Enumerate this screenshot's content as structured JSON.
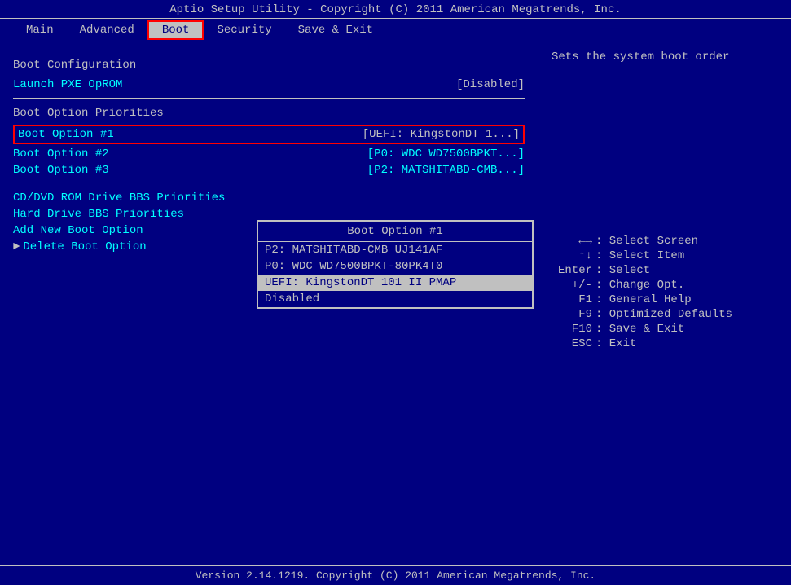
{
  "title_bar": {
    "text": "Aptio Setup Utility - Copyright (C) 2011 American Megatrends, Inc."
  },
  "menu": {
    "items": [
      {
        "id": "main",
        "label": "Main",
        "active": false
      },
      {
        "id": "advanced",
        "label": "Advanced",
        "active": false
      },
      {
        "id": "boot",
        "label": "Boot",
        "active": true
      },
      {
        "id": "security",
        "label": "Security",
        "active": false
      },
      {
        "id": "save_exit",
        "label": "Save & Exit",
        "active": false
      }
    ]
  },
  "left_panel": {
    "boot_config_header": "Boot Configuration",
    "launch_pxe_label": "Launch PXE OpROM",
    "launch_pxe_value": "[Disabled]",
    "boot_priorities_header": "Boot Option Priorities",
    "boot_option_1_label": "Boot Option #1",
    "boot_option_1_value": "[UEFI: KingstonDT 1...]",
    "boot_option_2_label": "Boot Option #2",
    "boot_option_2_value": "[P0: WDC WD7500BPKT...]",
    "boot_option_3_label": "Boot Option #3",
    "boot_option_3_value": "[P2: MATSHITABD-CMB...]",
    "cd_dvd_label": "CD/DVD ROM Drive BBS Priorities",
    "hard_drive_label": "Hard Drive BBS Priorities",
    "add_boot_label": "Add New Boot Option",
    "delete_boot_label": "Delete Boot Option"
  },
  "popup": {
    "title": "Boot Option #1",
    "items": [
      {
        "id": "p2",
        "label": "P2: MATSHITABD-CMB UJ141AF",
        "highlighted": false
      },
      {
        "id": "p0",
        "label": "P0: WDC WD7500BPKT-80PK4T0",
        "highlighted": false
      },
      {
        "id": "uefi",
        "label": "UEFI: KingstonDT 101 II PMAP",
        "highlighted": true
      },
      {
        "id": "disabled",
        "label": "Disabled",
        "highlighted": false
      }
    ]
  },
  "right_panel": {
    "help_text": "Sets the system boot order",
    "keys": [
      {
        "key": "←→",
        "desc": ": Select Screen"
      },
      {
        "key": "↑↓",
        "desc": ": Select Item"
      },
      {
        "key": "Enter",
        "desc": ": Select"
      },
      {
        "key": "+/-",
        "desc": ": Change Opt."
      },
      {
        "key": "F1",
        "desc": ": General Help"
      },
      {
        "key": "F9",
        "desc": ": Optimized Defaults"
      },
      {
        "key": "F10",
        "desc": ": Save & Exit"
      },
      {
        "key": "ESC",
        "desc": ": Exit"
      }
    ]
  },
  "bottom_bar": {
    "text": "Version 2.14.1219. Copyright (C) 2011 American Megatrends, Inc."
  }
}
